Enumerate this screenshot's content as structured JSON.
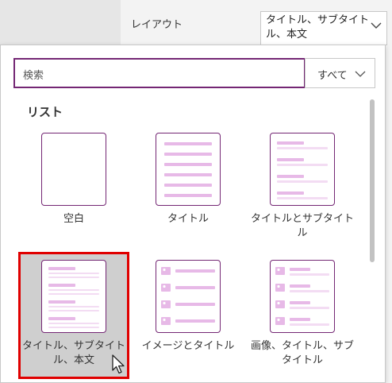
{
  "property_row": {
    "label": "レイアウト",
    "value": "タイトル、サブタイトル、本文"
  },
  "search": {
    "placeholder": "検索"
  },
  "filter": {
    "value": "すべて"
  },
  "section": {
    "title": "リスト"
  },
  "layouts": [
    {
      "label": "空白",
      "icon": "blank-layout-icon",
      "selected": false
    },
    {
      "label": "タイトル",
      "icon": "title-layout-icon",
      "selected": false
    },
    {
      "label": "タイトルとサブタイトル",
      "icon": "title-subtitle-layout-icon",
      "selected": false
    },
    {
      "label": "タイトル、サブタイトル、本文",
      "icon": "title-subtitle-body-layout-icon",
      "selected": true
    },
    {
      "label": "イメージとタイトル",
      "icon": "image-title-layout-icon",
      "selected": false
    },
    {
      "label": "画像、タイトル、サブタイトル",
      "icon": "image-title-subtitle-layout-icon",
      "selected": false
    }
  ],
  "colors": {
    "accent": "#742774",
    "thumb_line": "#e7b9e7",
    "thumb_line_light": "#f3dcf3",
    "selected_border": "#e00000",
    "selected_bg": "#cfcfcf"
  }
}
